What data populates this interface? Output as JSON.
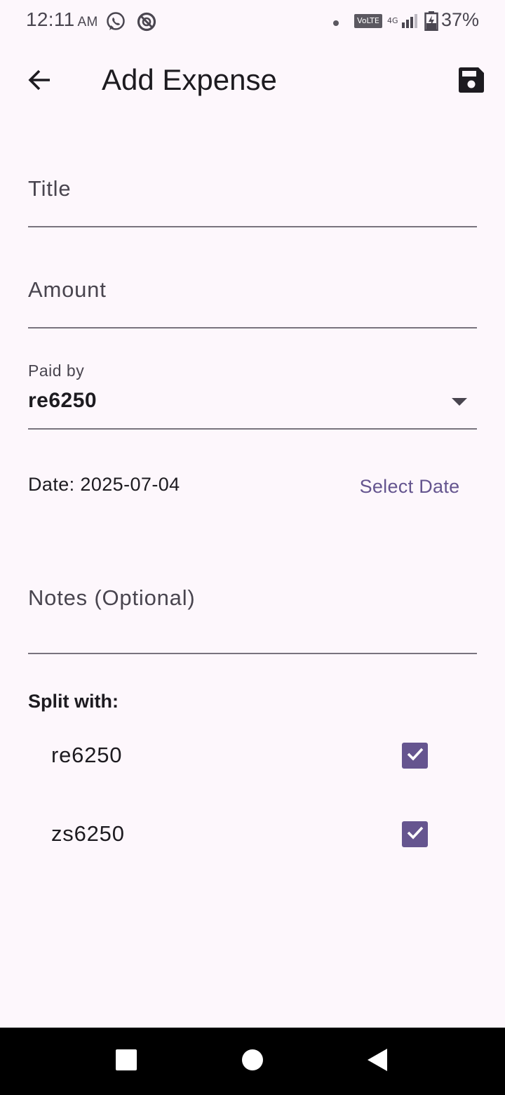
{
  "status_bar": {
    "time": "12:11",
    "ampm": "AM",
    "network_badge": "VoLTE",
    "network_type": "4G",
    "battery": "37%"
  },
  "app_bar": {
    "title": "Add Expense",
    "back_icon": "arrow-left-icon",
    "save_icon": "floppy-disk-icon"
  },
  "form": {
    "title_field": {
      "placeholder": "Title",
      "value": ""
    },
    "amount_field": {
      "placeholder": "Amount",
      "value": ""
    },
    "paid_by": {
      "label": "Paid by",
      "value": "re6250"
    },
    "date": {
      "text": "Date: 2025-07-04",
      "button_label": "Select Date"
    },
    "notes_field": {
      "placeholder": "Notes (Optional)",
      "value": ""
    },
    "split": {
      "heading": "Split with:",
      "members": [
        {
          "name": "re6250",
          "checked": true
        },
        {
          "name": "zs6250",
          "checked": true
        }
      ]
    }
  },
  "colors": {
    "background": "#fdf7fc",
    "primary": "#65558f",
    "text": "#1d1b20",
    "muted": "#49454f",
    "divider": "#79747e",
    "nav_bar": "#000000"
  }
}
